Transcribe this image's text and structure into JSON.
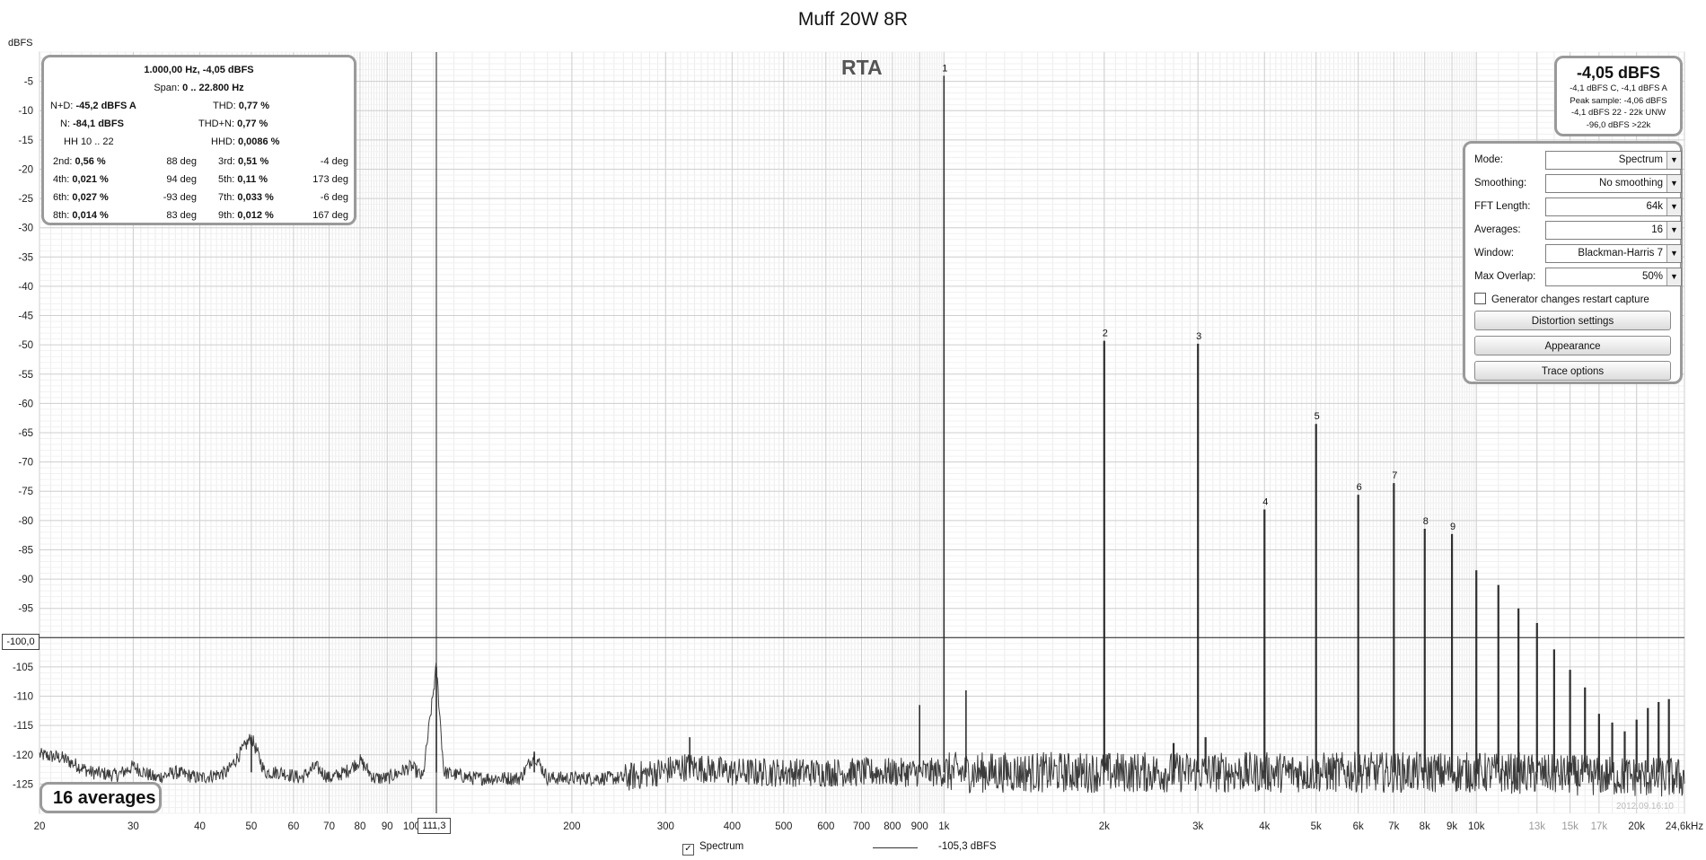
{
  "title": "Muff 20W 8R",
  "y_unit": "dBFS",
  "rta_label": "RTA",
  "cursor_level": "-100,0",
  "cursor_freq": "111,3",
  "averages_badge": "16 averages",
  "timestamp": "2012.09.16:10",
  "stats": {
    "header1": "1.000,00 Hz, -4,05 dBFS",
    "span_label": "Span:",
    "span_value": "0 .. 22.800 Hz",
    "nd_label": "N+D:",
    "nd_value": "-45,2 dBFS A",
    "thd_label": "THD:",
    "thd_value": "0,77 %",
    "n_label": "N:",
    "n_value": "-84,1 dBFS",
    "thdn_label": "THD+N:",
    "thdn_value": "0,77 %",
    "hh_label": "HH 10 .. 22",
    "hhd_label": "HHD:",
    "hhd_value": "0,0086 %",
    "harmonics": [
      {
        "l1": "2nd:",
        "v1": "0,56 %",
        "p1": "88 deg",
        "l2": "3rd:",
        "v2": "0,51 %",
        "p2": "-4 deg"
      },
      {
        "l1": "4th:",
        "v1": "0,021 %",
        "p1": "94 deg",
        "l2": "5th:",
        "v2": "0,11 %",
        "p2": "173 deg"
      },
      {
        "l1": "6th:",
        "v1": "0,027 %",
        "p1": "-93 deg",
        "l2": "7th:",
        "v2": "0,033 %",
        "p2": "-6 deg"
      },
      {
        "l1": "8th:",
        "v1": "0,014 %",
        "p1": "83 deg",
        "l2": "9th:",
        "v2": "0,012 %",
        "p2": "167 deg"
      }
    ]
  },
  "level": {
    "big": "-4,05 dBFS",
    "lines": [
      "-4,1 dBFS C, -4,1 dBFS A",
      "Peak sample: -4,06 dBFS",
      "-4,1 dBFS 22 - 22k UNW",
      "-96,0 dBFS >22k"
    ]
  },
  "settings": {
    "rows": [
      {
        "label": "Mode:",
        "value": "Spectrum"
      },
      {
        "label": "Smoothing:",
        "value": "No  smoothing"
      },
      {
        "label": "FFT Length:",
        "value": "64k"
      },
      {
        "label": "Averages:",
        "value": "16"
      },
      {
        "label": "Window:",
        "value": "Blackman-Harris 7"
      },
      {
        "label": "Max Overlap:",
        "value": "50%"
      }
    ],
    "checkbox_label": "Generator changes restart capture",
    "buttons": [
      "Distortion settings",
      "Appearance",
      "Trace options"
    ]
  },
  "legend": {
    "series": "Spectrum",
    "value": "-105,3 dBFS"
  },
  "chart_data": {
    "type": "line",
    "title": "Muff 20W 8R",
    "ylabel": "dBFS",
    "xscale": "log",
    "xlim": [
      20,
      24600
    ],
    "ylim": [
      -130,
      0
    ],
    "grid": true,
    "yticks": [
      -5,
      -10,
      -15,
      -20,
      -25,
      -30,
      -35,
      -40,
      -45,
      -50,
      -55,
      -60,
      -65,
      -70,
      -75,
      -80,
      -85,
      -90,
      -95,
      -100,
      -105,
      -110,
      -115,
      -120,
      -125
    ],
    "xticks": [
      {
        "v": 20,
        "t": "20"
      },
      {
        "v": 30,
        "t": "30"
      },
      {
        "v": 40,
        "t": "40"
      },
      {
        "v": 50,
        "t": "50"
      },
      {
        "v": 60,
        "t": "60"
      },
      {
        "v": 70,
        "t": "70"
      },
      {
        "v": 80,
        "t": "80"
      },
      {
        "v": 90,
        "t": "90"
      },
      {
        "v": 100,
        "t": "100"
      },
      {
        "v": 200,
        "t": "200"
      },
      {
        "v": 300,
        "t": "300"
      },
      {
        "v": 400,
        "t": "400"
      },
      {
        "v": 500,
        "t": "500"
      },
      {
        "v": 600,
        "t": "600"
      },
      {
        "v": 700,
        "t": "700"
      },
      {
        "v": 800,
        "t": "800"
      },
      {
        "v": 900,
        "t": "900"
      },
      {
        "v": 1000,
        "t": "1k"
      },
      {
        "v": 2000,
        "t": "2k"
      },
      {
        "v": 3000,
        "t": "3k"
      },
      {
        "v": 4000,
        "t": "4k"
      },
      {
        "v": 5000,
        "t": "5k"
      },
      {
        "v": 6000,
        "t": "6k"
      },
      {
        "v": 7000,
        "t": "7k"
      },
      {
        "v": 8000,
        "t": "8k"
      },
      {
        "v": 9000,
        "t": "9k"
      },
      {
        "v": 10000,
        "t": "10k"
      },
      {
        "v": 13000,
        "t": "13k"
      },
      {
        "v": 15000,
        "t": "15k"
      },
      {
        "v": 17000,
        "t": "17k"
      },
      {
        "v": 20000,
        "t": "20k"
      },
      {
        "v": 24600,
        "t": "24,6kHz"
      }
    ],
    "cursor": {
      "x": 111.3,
      "y": -100
    },
    "noise_floor": [
      [
        20,
        -120
      ],
      [
        22,
        -120.5
      ],
      [
        25,
        -123
      ],
      [
        28,
        -123.5
      ],
      [
        30,
        -122
      ],
      [
        33,
        -124
      ],
      [
        36,
        -123
      ],
      [
        40,
        -124
      ],
      [
        45,
        -123
      ],
      [
        50,
        -117
      ],
      [
        53,
        -123
      ],
      [
        57,
        -123
      ],
      [
        62,
        -124
      ],
      [
        66,
        -122
      ],
      [
        70,
        -124
      ],
      [
        75,
        -123
      ],
      [
        80,
        -121
      ],
      [
        85,
        -124
      ],
      [
        90,
        -124
      ],
      [
        95,
        -123
      ],
      [
        100,
        -122
      ],
      [
        105,
        -124
      ],
      [
        111.3,
        -105
      ],
      [
        115,
        -123
      ],
      [
        130,
        -124
      ],
      [
        160,
        -124
      ],
      [
        170,
        -120
      ],
      [
        180,
        -124
      ],
      [
        250,
        -124
      ],
      [
        330,
        -122
      ],
      [
        400,
        -123
      ],
      [
        600,
        -123
      ],
      [
        900,
        -123
      ],
      [
        1200,
        -123
      ],
      [
        2000,
        -123
      ],
      [
        5000,
        -123
      ],
      [
        10000,
        -123
      ],
      [
        24600,
        -124
      ]
    ],
    "peaks": [
      {
        "f": 50,
        "db": -117,
        "label": ""
      },
      {
        "f": 111.3,
        "db": -105,
        "label": ""
      },
      {
        "f": 170,
        "db": -119.5,
        "label": ""
      },
      {
        "f": 333,
        "db": -117,
        "label": ""
      },
      {
        "f": 900,
        "db": -111.5,
        "label": ""
      },
      {
        "f": 1000,
        "db": -4.05,
        "label": "1"
      },
      {
        "f": 1100,
        "db": -109,
        "label": ""
      },
      {
        "f": 2000,
        "db": -49.3,
        "label": "2"
      },
      {
        "f": 2700,
        "db": -118,
        "label": ""
      },
      {
        "f": 3000,
        "db": -49.8,
        "label": "3"
      },
      {
        "f": 3100,
        "db": -117,
        "label": ""
      },
      {
        "f": 4000,
        "db": -78.1,
        "label": "4"
      },
      {
        "f": 5000,
        "db": -63.5,
        "label": "5"
      },
      {
        "f": 6000,
        "db": -75.6,
        "label": "6"
      },
      {
        "f": 7000,
        "db": -73.6,
        "label": "7"
      },
      {
        "f": 8000,
        "db": -81.4,
        "label": "8"
      },
      {
        "f": 9000,
        "db": -82.3,
        "label": "9"
      },
      {
        "f": 10000,
        "db": -88.5,
        "label": ""
      },
      {
        "f": 11000,
        "db": -91,
        "label": ""
      },
      {
        "f": 12000,
        "db": -95,
        "label": ""
      },
      {
        "f": 13000,
        "db": -97.5,
        "label": ""
      },
      {
        "f": 14000,
        "db": -102,
        "label": ""
      },
      {
        "f": 15000,
        "db": -105.5,
        "label": ""
      },
      {
        "f": 16000,
        "db": -108.5,
        "label": ""
      },
      {
        "f": 17000,
        "db": -113,
        "label": ""
      },
      {
        "f": 18000,
        "db": -114.5,
        "label": ""
      },
      {
        "f": 19000,
        "db": -116,
        "label": ""
      },
      {
        "f": 20000,
        "db": -114,
        "label": ""
      },
      {
        "f": 21000,
        "db": -112,
        "label": ""
      },
      {
        "f": 22000,
        "db": -111,
        "label": ""
      },
      {
        "f": 23000,
        "db": -110.5,
        "label": ""
      }
    ]
  }
}
